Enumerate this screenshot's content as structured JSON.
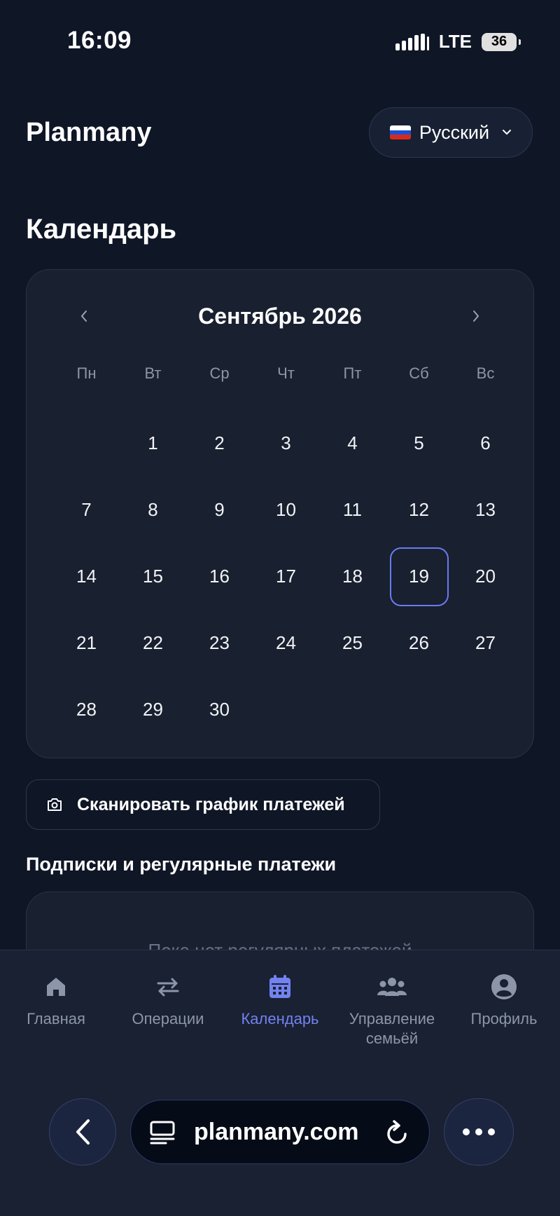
{
  "status_bar": {
    "time": "16:09",
    "network": "LTE",
    "battery": "36"
  },
  "header": {
    "logo": "Planmany",
    "language": "Русский"
  },
  "page": {
    "title": "Календарь"
  },
  "calendar": {
    "month_label": "Сентябрь 2026",
    "weekdays": [
      "Пн",
      "Вт",
      "Ср",
      "Чт",
      "Пт",
      "Сб",
      "Вс"
    ],
    "days": [
      "",
      "1",
      "2",
      "3",
      "4",
      "5",
      "6",
      "7",
      "8",
      "9",
      "10",
      "11",
      "12",
      "13",
      "14",
      "15",
      "16",
      "17",
      "18",
      "19",
      "20",
      "21",
      "22",
      "23",
      "24",
      "25",
      "26",
      "27",
      "28",
      "29",
      "30"
    ],
    "selected_day": "19"
  },
  "actions": {
    "scan_label": "Сканировать график платежей"
  },
  "subscriptions": {
    "title": "Подписки и регулярные платежи",
    "empty_text": "Пока нет регулярных платежей"
  },
  "bottom_nav": {
    "items": [
      {
        "label": "Главная",
        "icon": "home-icon"
      },
      {
        "label": "Операции",
        "icon": "arrows-swap-icon"
      },
      {
        "label": "Календарь",
        "icon": "calendar-icon"
      },
      {
        "label": "Управление семьёй",
        "icon": "users-icon"
      },
      {
        "label": "Профиль",
        "icon": "user-circle-icon"
      }
    ],
    "active_index": 2
  },
  "browser": {
    "url": "planmany.com"
  },
  "colors": {
    "background": "#0f1626",
    "card": "#19202f",
    "accent": "#7282f0",
    "muted": "#8d96a9"
  }
}
